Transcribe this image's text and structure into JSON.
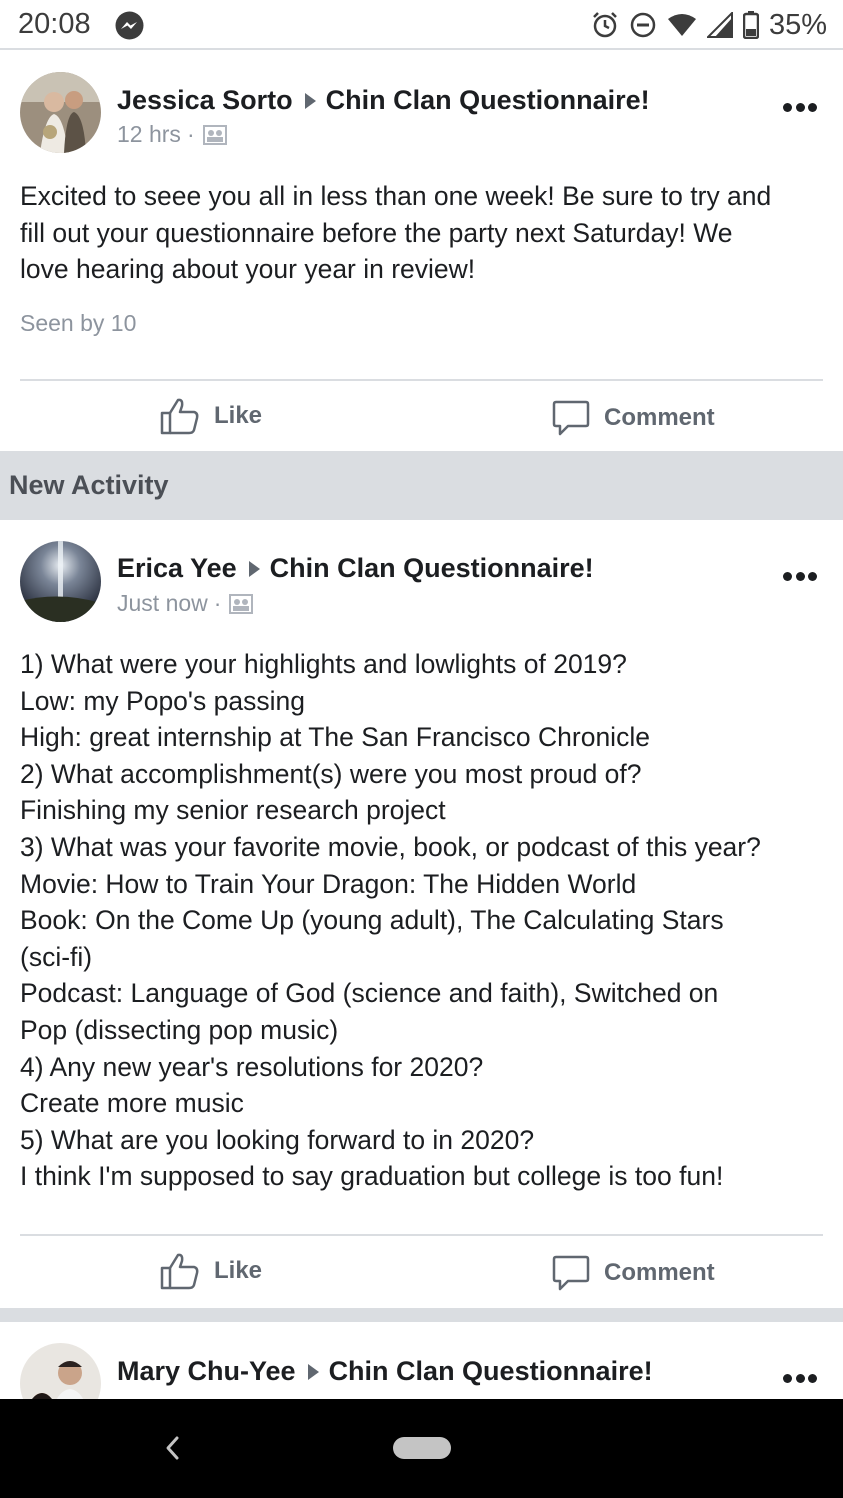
{
  "status_bar": {
    "time": "20:08",
    "battery": "35%",
    "icons": [
      "messenger-icon",
      "alarm-icon",
      "dnd-icon",
      "wifi-icon",
      "signal-icon",
      "battery-icon"
    ]
  },
  "posts": [
    {
      "author": "Jessica Sorto",
      "group": "Chin Clan Questionnaire!",
      "time": "12 hrs",
      "separator": "·",
      "body": [
        "Excited to seee you all in less than one week! Be sure to try and",
        "fill out your questionnaire before the party next Saturday! We",
        "love hearing about your year in review!"
      ],
      "seen_by": "Seen by 10",
      "like_label": "Like",
      "comment_label": "Comment"
    },
    {
      "author": "Erica Yee",
      "group": "Chin Clan Questionnaire!",
      "time": "Just now",
      "separator": "·",
      "body": [
        "1) What were your highlights and lowlights of 2019?",
        "Low: my Popo's passing",
        "High: great internship at The San Francisco Chronicle",
        "2) What accomplishment(s) were you most proud of?",
        "Finishing my senior research project",
        "3) What was your favorite movie, book, or podcast of this year?",
        "Movie: How to Train Your Dragon: The Hidden World",
        "Book: On the Come Up (young adult), The Calculating Stars",
        "(sci-fi)",
        "Podcast: Language of God (science and faith), Switched on",
        "Pop (dissecting pop music)",
        "4) Any new year's resolutions for 2020?",
        "Create more music",
        "5) What are you looking forward to in 2020?",
        "I think I'm supposed to say graduation but college is too fun!"
      ],
      "like_label": "Like",
      "comment_label": "Comment"
    },
    {
      "author": "Mary Chu-Yee",
      "group": "Chin Clan Questionnaire!"
    }
  ],
  "section_header": "New Activity",
  "colors": {
    "text": "#1c1e21",
    "secondary": "#606770",
    "muted": "#8d949e",
    "divider": "#dadde1",
    "navbar": "#000000"
  }
}
